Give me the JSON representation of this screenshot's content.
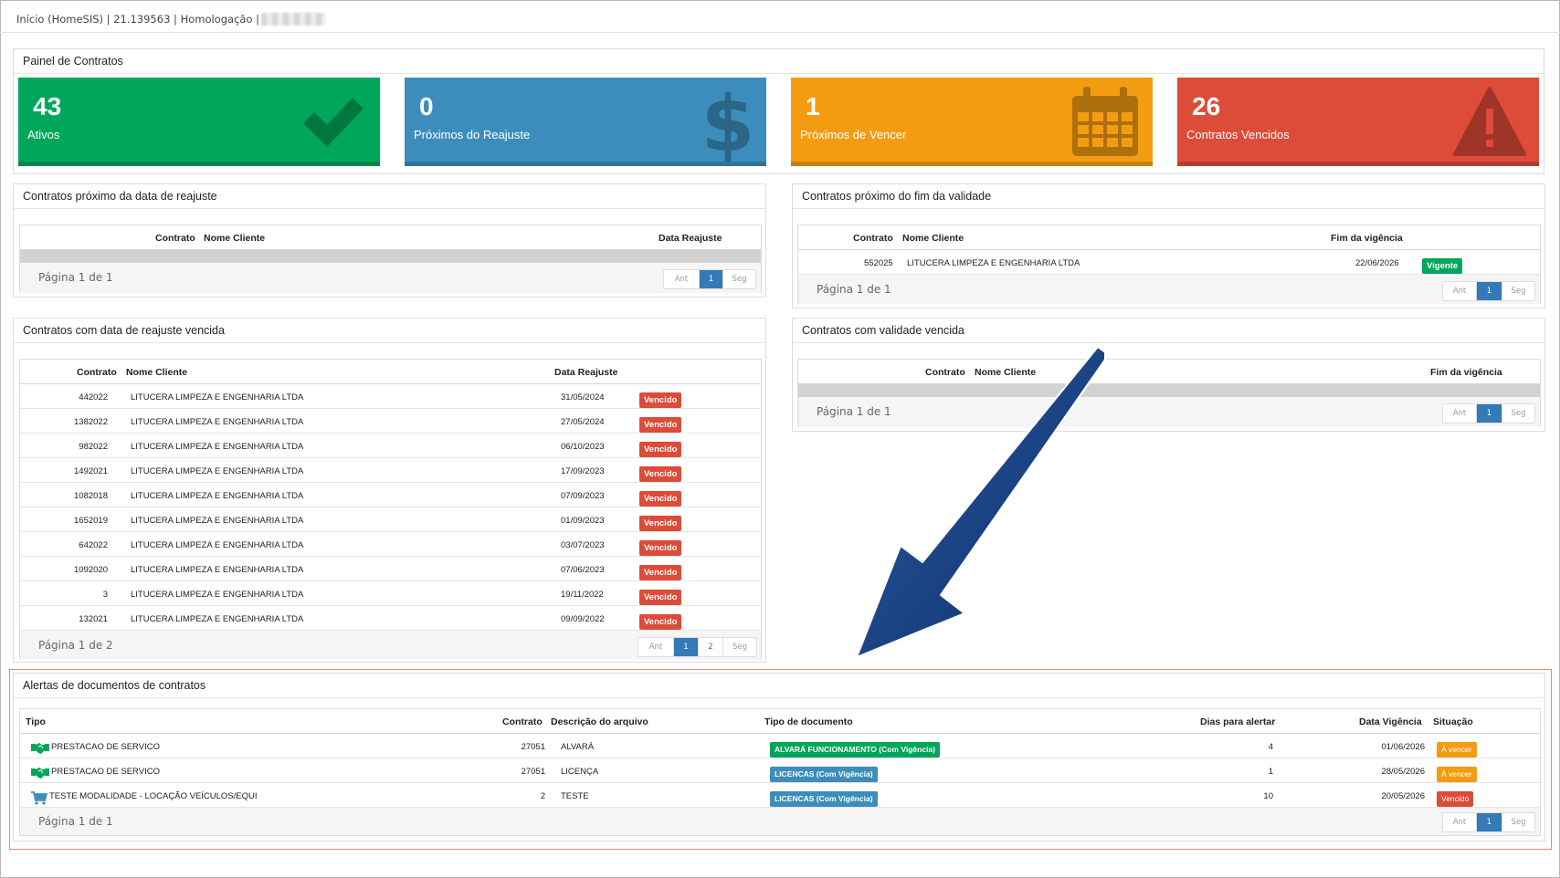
{
  "breadcrumb": {
    "text": "Início (HomeSIS) | 21.139563 | Homologação |"
  },
  "panel": {
    "title": "Painel de Contratos"
  },
  "cards": [
    {
      "num": "43",
      "label": "Ativos",
      "color": "#00a65a",
      "icon": "check-icon"
    },
    {
      "num": "0",
      "label": "Próximos do Reajuste",
      "color": "#3c8dbc",
      "icon": "dollar-icon"
    },
    {
      "num": "1",
      "label": "Próximos de Vencer",
      "color": "#f39c12",
      "icon": "calendar-icon"
    },
    {
      "num": "26",
      "label": "Contratos Vencidos",
      "color": "#dd4b39",
      "icon": "warning-icon"
    }
  ],
  "reajuste": {
    "title": "Contratos próximo da data de reajuste",
    "headers": {
      "contrato": "Contrato",
      "cliente": "Nome Cliente",
      "data": "Data Reajuste"
    },
    "page": "Página 1 de 1"
  },
  "validade": {
    "title": "Contratos próximo do fim da validade",
    "headers": {
      "contrato": "Contrato",
      "cliente": "Nome Cliente",
      "data": "Fim da vigência"
    },
    "row": {
      "contrato": "552025",
      "cliente": "LITUCERA LIMPEZA E ENGENHARIA LTDA",
      "data": "22/06/2026",
      "status": "Vigente"
    },
    "page": "Página 1 de 1"
  },
  "reajusteVencida": {
    "title": "Contratos com data de reajuste vencida",
    "headers": {
      "contrato": "Contrato",
      "cliente": "Nome Cliente",
      "data": "Data Reajuste"
    },
    "rows": [
      {
        "contrato": "442022",
        "cliente": "LITUCERA LIMPEZA E ENGENHARIA LTDA",
        "data": "31/05/2024",
        "status": "Vencido"
      },
      {
        "contrato": "1382022",
        "cliente": "LITUCERA LIMPEZA E ENGENHARIA LTDA",
        "data": "27/05/2024",
        "status": "Vencido"
      },
      {
        "contrato": "982022",
        "cliente": "LITUCERA LIMPEZA E ENGENHARIA LTDA",
        "data": "06/10/2023",
        "status": "Vencido"
      },
      {
        "contrato": "1492021",
        "cliente": "LITUCERA LIMPEZA E ENGENHARIA LTDA",
        "data": "17/09/2023",
        "status": "Vencido"
      },
      {
        "contrato": "1082018",
        "cliente": "LITUCERA LIMPEZA E ENGENHARIA LTDA",
        "data": "07/09/2023",
        "status": "Vencido"
      },
      {
        "contrato": "1652019",
        "cliente": "LITUCERA LIMPEZA E ENGENHARIA LTDA",
        "data": "01/09/2023",
        "status": "Vencido"
      },
      {
        "contrato": "642022",
        "cliente": "LITUCERA LIMPEZA E ENGENHARIA LTDA",
        "data": "03/07/2023",
        "status": "Vencido"
      },
      {
        "contrato": "1092020",
        "cliente": "LITUCERA LIMPEZA E ENGENHARIA LTDA",
        "data": "07/06/2023",
        "status": "Vencido"
      },
      {
        "contrato": "3",
        "cliente": "LITUCERA LIMPEZA E ENGENHARIA LTDA",
        "data": "19/11/2022",
        "status": "Vencido"
      },
      {
        "contrato": "132021",
        "cliente": "LITUCERA LIMPEZA E ENGENHARIA LTDA",
        "data": "09/09/2022",
        "status": "Vencido"
      }
    ],
    "page": "Página 1 de 2"
  },
  "validadeVencida": {
    "title": "Contratos com validade vencida",
    "headers": {
      "contrato": "Contrato",
      "cliente": "Nome Cliente",
      "data": "Fim da vigência"
    },
    "page": "Página 1 de 1"
  },
  "alertas": {
    "title": "Alertas de documentos de contratos",
    "headers": {
      "tipo": "Tipo",
      "contrato": "Contrato",
      "descricao": "Descrição do arquivo",
      "tipodoc": "Tipo de documento",
      "dias": "Dias para alertar",
      "data": "Data Vigência",
      "situacao": "Situação"
    },
    "rows": [
      {
        "icon": "handshake-icon",
        "tipo": "PRESTACAO DE SERVICO",
        "contrato": "27051",
        "descricao": "ALVARÁ",
        "tipodoc": "ALVARÁ FUNCIONAMENTO (Com Vigência)",
        "tipodocColor": "#00a65a",
        "dias": "4",
        "data": "01/06/2026",
        "situacao": "À vencer",
        "situacaoColor": "#f39c12"
      },
      {
        "icon": "handshake-icon",
        "tipo": "PRESTACAO DE SERVICO",
        "contrato": "27051",
        "descricao": "LICENÇA",
        "tipodoc": "LICENCAS (Com Vigência)",
        "tipodocColor": "#3c8dbc",
        "dias": "1",
        "data": "28/05/2026",
        "situacao": "À vencer",
        "situacaoColor": "#f39c12"
      },
      {
        "icon": "cart-icon",
        "tipo": "TESTE MODALIDADE - LOCAÇÃO VEÍCULOS/EQUI",
        "contrato": "2",
        "descricao": "TESTE",
        "tipodoc": "LICENCAS (Com Vigência)",
        "tipodocColor": "#3c8dbc",
        "dias": "10",
        "data": "20/05/2026",
        "situacao": "Vencido",
        "situacaoColor": "#dd4b39"
      }
    ],
    "page": "Página 1 de 1"
  },
  "pager": {
    "prev": "Ant",
    "next": "Seg",
    "p1": "1",
    "p2": "2"
  }
}
